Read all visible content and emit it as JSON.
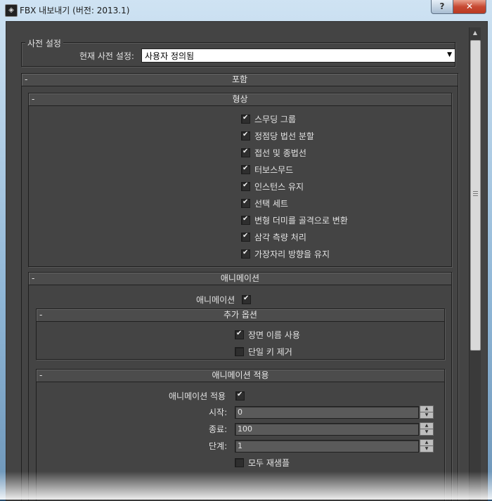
{
  "window": {
    "title": "FBX 내보내기 (버전: 2013.1)",
    "help_label": "?",
    "close_label": "✕"
  },
  "presets": {
    "group_title": "사전 설정",
    "current_label": "현재 사전 설정:",
    "current_value": "사용자 정의됨"
  },
  "include": {
    "title": "포함",
    "toggle": "-",
    "geometry": {
      "title": "형상",
      "toggle": "-",
      "options": [
        {
          "label": "스무딩 그룹",
          "checked": true
        },
        {
          "label": "정점당 법선 분할",
          "checked": true
        },
        {
          "label": "접선 및 종법선",
          "checked": true
        },
        {
          "label": "터보스무드",
          "checked": true
        },
        {
          "label": "인스턴스 유지",
          "checked": true
        },
        {
          "label": "선택 세트",
          "checked": true
        },
        {
          "label": "변형 더미를 골격으로 변환",
          "checked": true
        },
        {
          "label": "삼각 측량 처리",
          "checked": true
        },
        {
          "label": "가장자리 방향을 유지",
          "checked": true
        }
      ]
    },
    "animation": {
      "title": "애니메이션",
      "toggle": "-",
      "enable_label": "애니메이션",
      "enable_checked": true,
      "extra": {
        "title": "추가 옵션",
        "toggle": "-",
        "options": [
          {
            "label": "장면 이름 사용",
            "checked": true
          },
          {
            "label": "단일 키 제거",
            "checked": false
          }
        ]
      },
      "bake": {
        "title": "애니메이션 적용",
        "toggle": "-",
        "enable_label": "애니메이션 적용",
        "enable_checked": true,
        "start_label": "시작:",
        "start_value": "0",
        "end_label": "종료:",
        "end_value": "100",
        "step_label": "단계:",
        "step_value": "1",
        "resample_label": "모두 재샘플",
        "resample_checked": false
      }
    }
  }
}
